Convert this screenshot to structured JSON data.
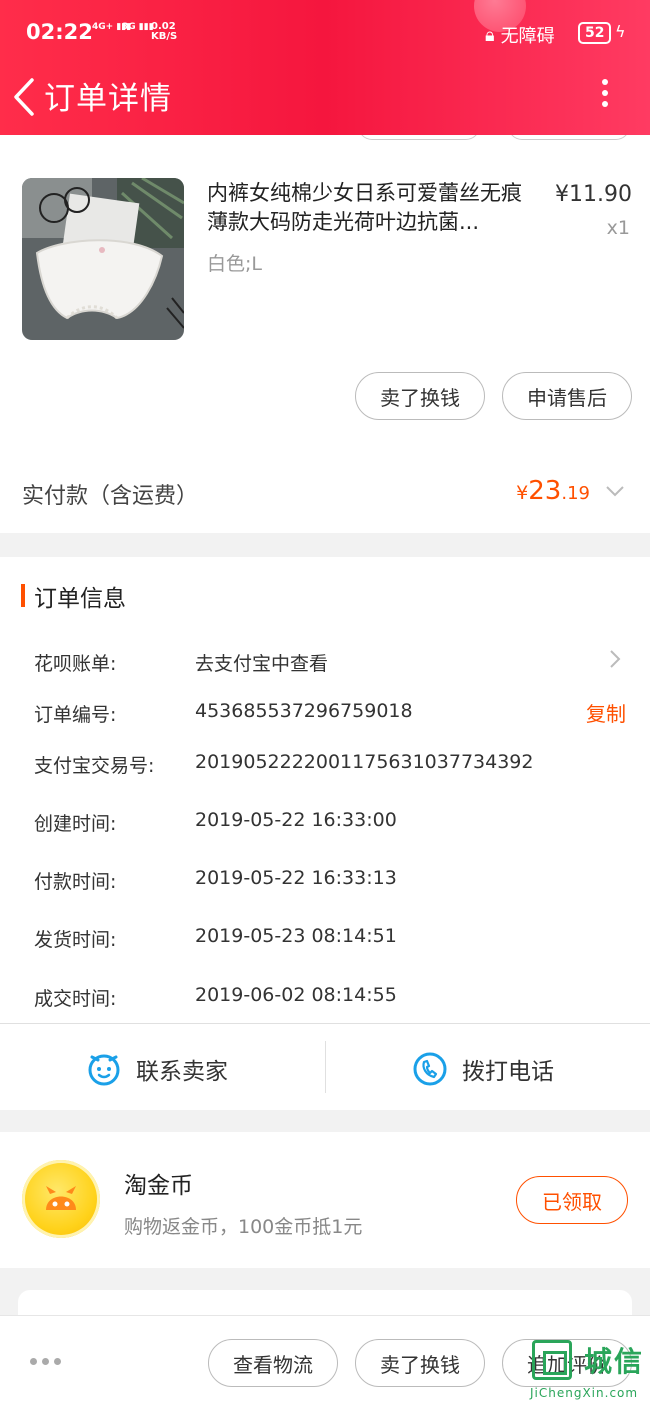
{
  "status_bar": {
    "time": "02:22",
    "signal1": "4G+",
    "signal2": "3G",
    "net_speed_value": "0.02",
    "net_speed_unit": "KB/S",
    "accessibility": "无障碍",
    "battery": "52"
  },
  "nav": {
    "title": "订单详情"
  },
  "product": {
    "title": "内裤女纯棉少女日系可爱蕾丝无痕薄款大码防走光荷叶边抗菌...",
    "spec": "白色;L",
    "price": "¥11.90",
    "qty": "x1",
    "actions": [
      "卖了换钱",
      "申请售后"
    ]
  },
  "total": {
    "label": "实付款（含运费）",
    "currency": "¥",
    "amount_int": "23",
    "amount_dec": ".19"
  },
  "order_info": {
    "title": "订单信息",
    "rows": [
      {
        "label": "花呗账单:",
        "value": "去支付宝中查看"
      },
      {
        "label": "订单编号:",
        "value": "453685537296759018"
      },
      {
        "label": "支付宝交易号:",
        "value": "2019052222001175631037734392"
      },
      {
        "label": "创建时间:",
        "value": "2019-05-22 16:33:00"
      },
      {
        "label": "付款时间:",
        "value": "2019-05-22 16:33:13"
      },
      {
        "label": "发货时间:",
        "value": "2019-05-23 08:14:51"
      },
      {
        "label": "成交时间:",
        "value": "2019-06-02 08:14:55"
      }
    ],
    "copy_label": "复制",
    "contact_seller": "联系卖家",
    "call_phone": "拨打电话"
  },
  "coin": {
    "title": "淘金币",
    "subtitle": "购物返金币，100金币抵1元",
    "button": "已领取"
  },
  "bottom_bar": {
    "buttons": [
      "查看物流",
      "卖了换钱",
      "追加评价"
    ]
  },
  "watermark": {
    "text": "城信",
    "sub": "JiChengXin.com"
  },
  "colors": {
    "accent": "#ff5000",
    "header": "#f5163e",
    "contact_icon": "#1aa0e8"
  }
}
